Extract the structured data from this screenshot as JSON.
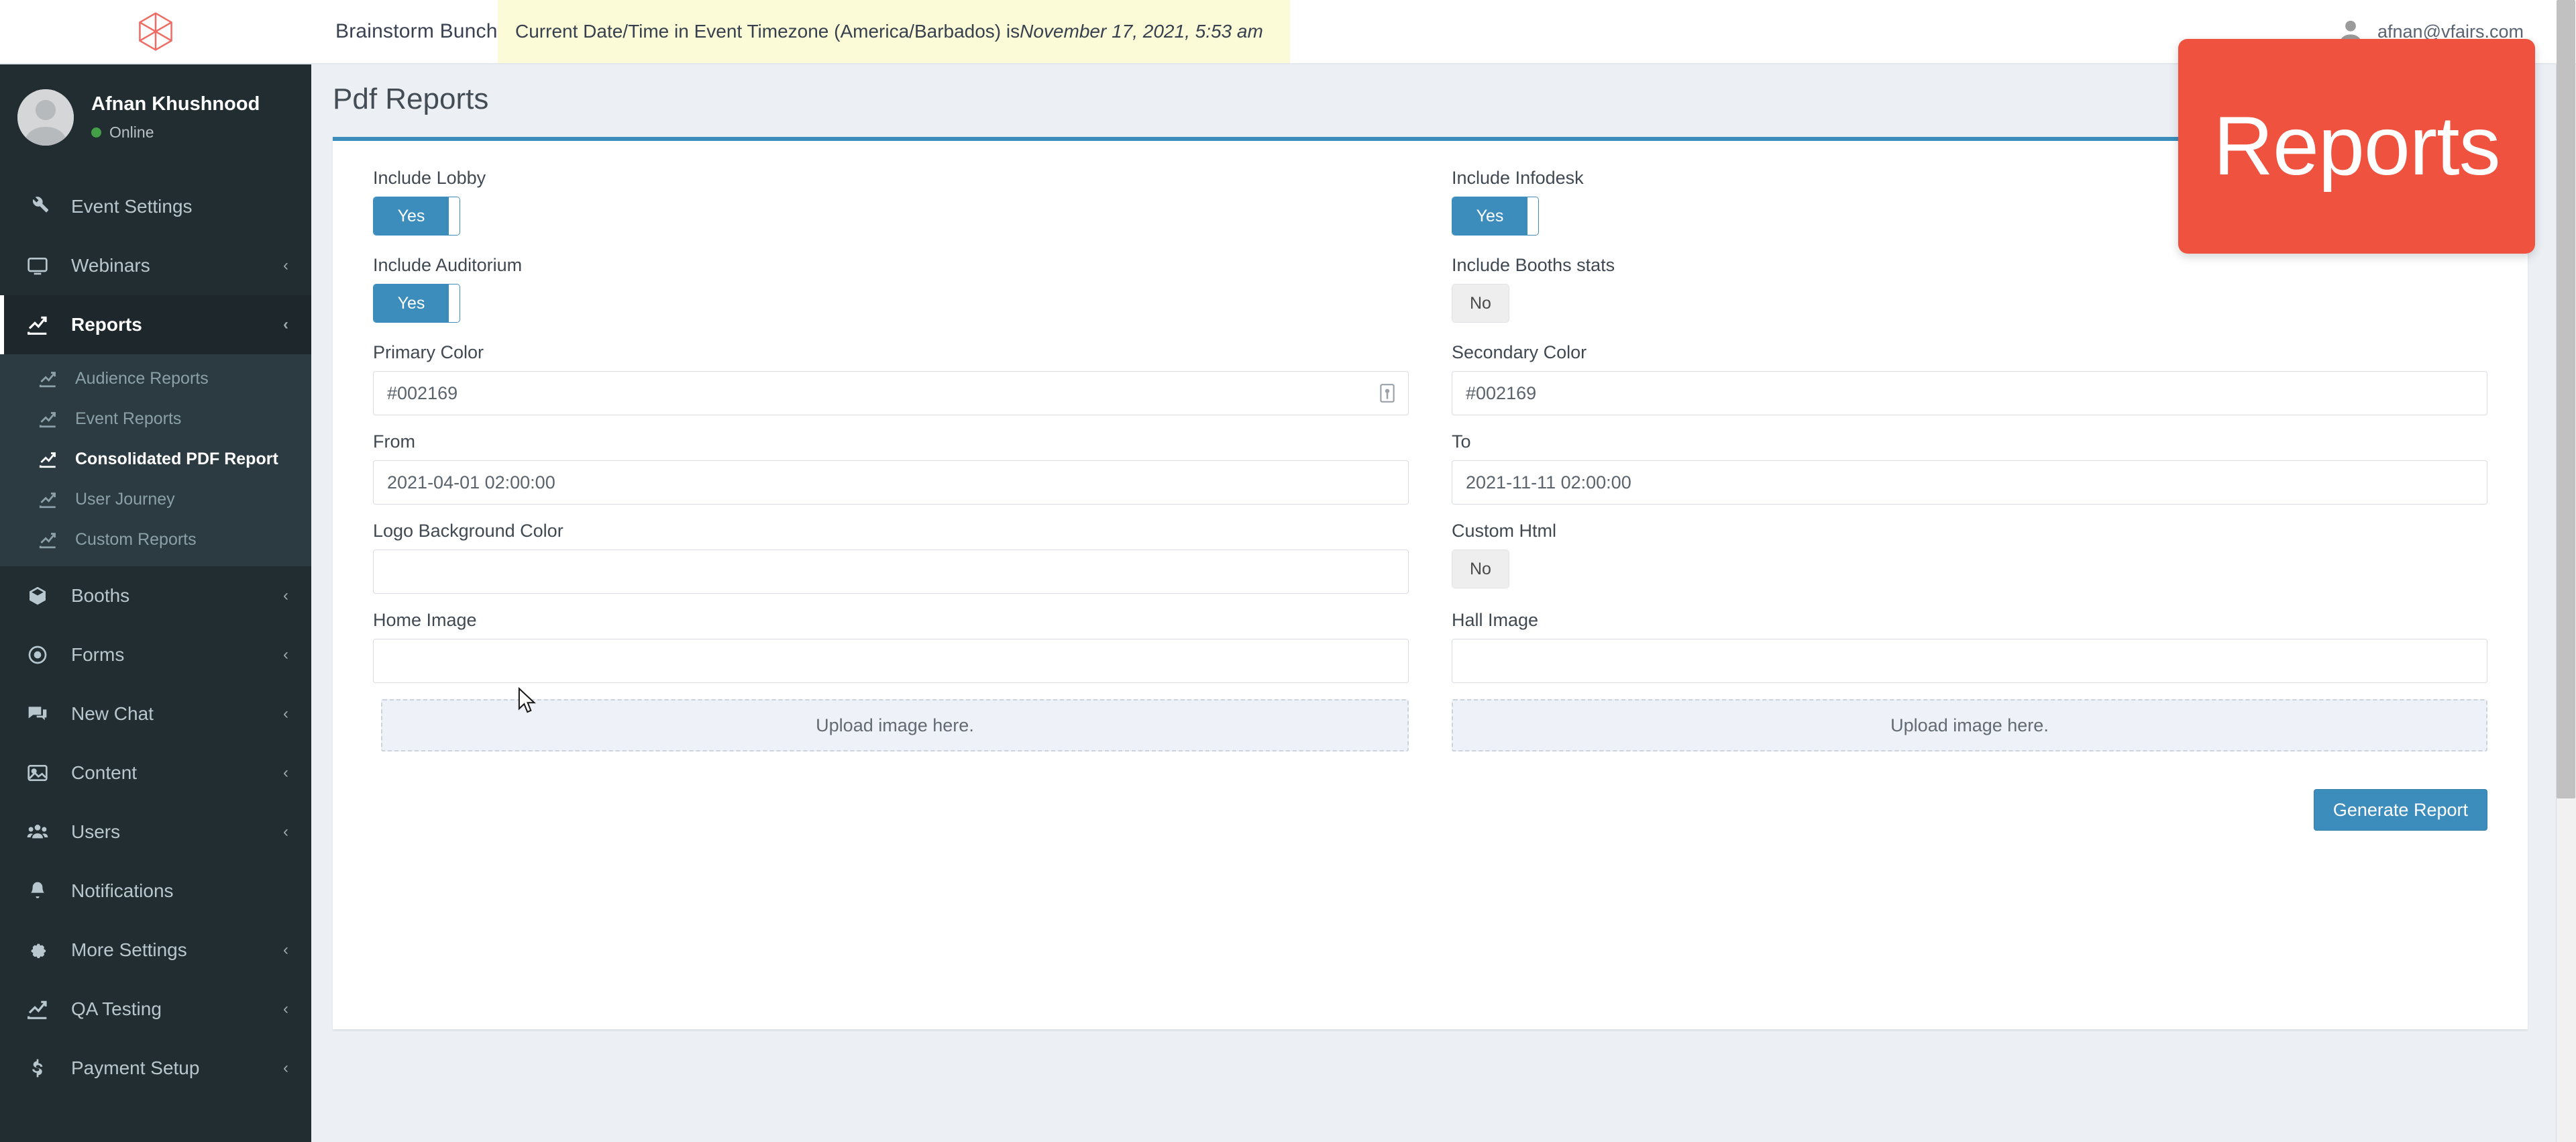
{
  "topbar": {
    "logo_icon": "vfairs-hexagon-logo",
    "brand_tab": "Brainstorm Bunch",
    "timezone_notice_prefix": "Current Date/Time in Event Timezone (America/Barbados) is ",
    "timezone_notice_datetime": "November 17, 2021, 5:53 am",
    "user_email": "afnan@vfairs.com",
    "user_icon": "user-avatar-icon"
  },
  "sidebar": {
    "profile": {
      "name": "Afnan Khushnood",
      "status": "Online",
      "avatar_icon": "user-avatar-icon"
    },
    "items": [
      {
        "label": "Event Settings",
        "icon": "wrench-icon",
        "caret": "",
        "active": false
      },
      {
        "label": "Webinars",
        "icon": "monitor-icon",
        "caret": "‹",
        "active": false
      },
      {
        "label": "Reports",
        "icon": "chart-line-icon",
        "caret": "‹",
        "active": true
      },
      {
        "label": "Booths",
        "icon": "cube-icon",
        "caret": "‹",
        "active": false
      },
      {
        "label": "Forms",
        "icon": "eye-icon",
        "caret": "‹",
        "active": false
      },
      {
        "label": "New Chat",
        "icon": "chat-bubbles-icon",
        "caret": "‹",
        "active": false
      },
      {
        "label": "Content",
        "icon": "image-icon",
        "caret": "‹",
        "active": false
      },
      {
        "label": "Users",
        "icon": "users-group-icon",
        "caret": "‹",
        "active": false
      },
      {
        "label": "Notifications",
        "icon": "bell-icon",
        "caret": "",
        "active": false
      },
      {
        "label": "More Settings",
        "icon": "gear-icon",
        "caret": "‹",
        "active": false
      },
      {
        "label": "QA Testing",
        "icon": "chart-line-icon",
        "caret": "‹",
        "active": false
      },
      {
        "label": "Payment Setup",
        "icon": "dollar-icon",
        "caret": "‹",
        "active": false
      }
    ],
    "subitems": [
      {
        "label": "Audience Reports",
        "icon": "chart-line-icon",
        "current": false
      },
      {
        "label": "Event Reports",
        "icon": "chart-line-icon",
        "current": false
      },
      {
        "label": "Consolidated PDF Report",
        "icon": "chart-line-icon",
        "current": true
      },
      {
        "label": "User Journey",
        "icon": "chart-line-icon",
        "current": false
      },
      {
        "label": "Custom Reports",
        "icon": "chart-line-icon",
        "current": false
      }
    ]
  },
  "page": {
    "title": "Pdf Reports"
  },
  "form": {
    "include_lobby": {
      "label": "Include Lobby",
      "value": "Yes",
      "on": true
    },
    "include_infodesk": {
      "label": "Include Infodesk",
      "value": "Yes",
      "on": true
    },
    "include_auditorium": {
      "label": "Include Auditorium",
      "value": "Yes",
      "on": true
    },
    "include_booths_stats": {
      "label": "Include Booths stats",
      "value": "No",
      "on": false
    },
    "primary_color": {
      "label": "Primary Color",
      "value": "#002169",
      "icon": "eyedropper-icon"
    },
    "secondary_color": {
      "label": "Secondary Color",
      "value": "#002169"
    },
    "from": {
      "label": "From",
      "value": "2021-04-01 02:00:00"
    },
    "to": {
      "label": "To",
      "value": "2021-11-11 02:00:00"
    },
    "logo_background_color": {
      "label": "Logo Background Color",
      "value": ""
    },
    "custom_html": {
      "label": "Custom Html",
      "value": "No",
      "on": false
    },
    "home_image": {
      "label": "Home Image",
      "value": "",
      "dropzone": "Upload image here."
    },
    "hall_image": {
      "label": "Hall Image",
      "value": "",
      "dropzone": "Upload image here."
    },
    "generate_button": "Generate Report"
  },
  "overlay": {
    "badge_text": "Reports",
    "badge_color": "#ef5340"
  },
  "colors": {
    "sidebar_bg": "#222d32",
    "sidebar_sub_bg": "#2c3b41",
    "accent_blue": "#3c8dbc",
    "content_bg": "#ecf0f5",
    "banner_yellow": "#fbfbd8"
  }
}
